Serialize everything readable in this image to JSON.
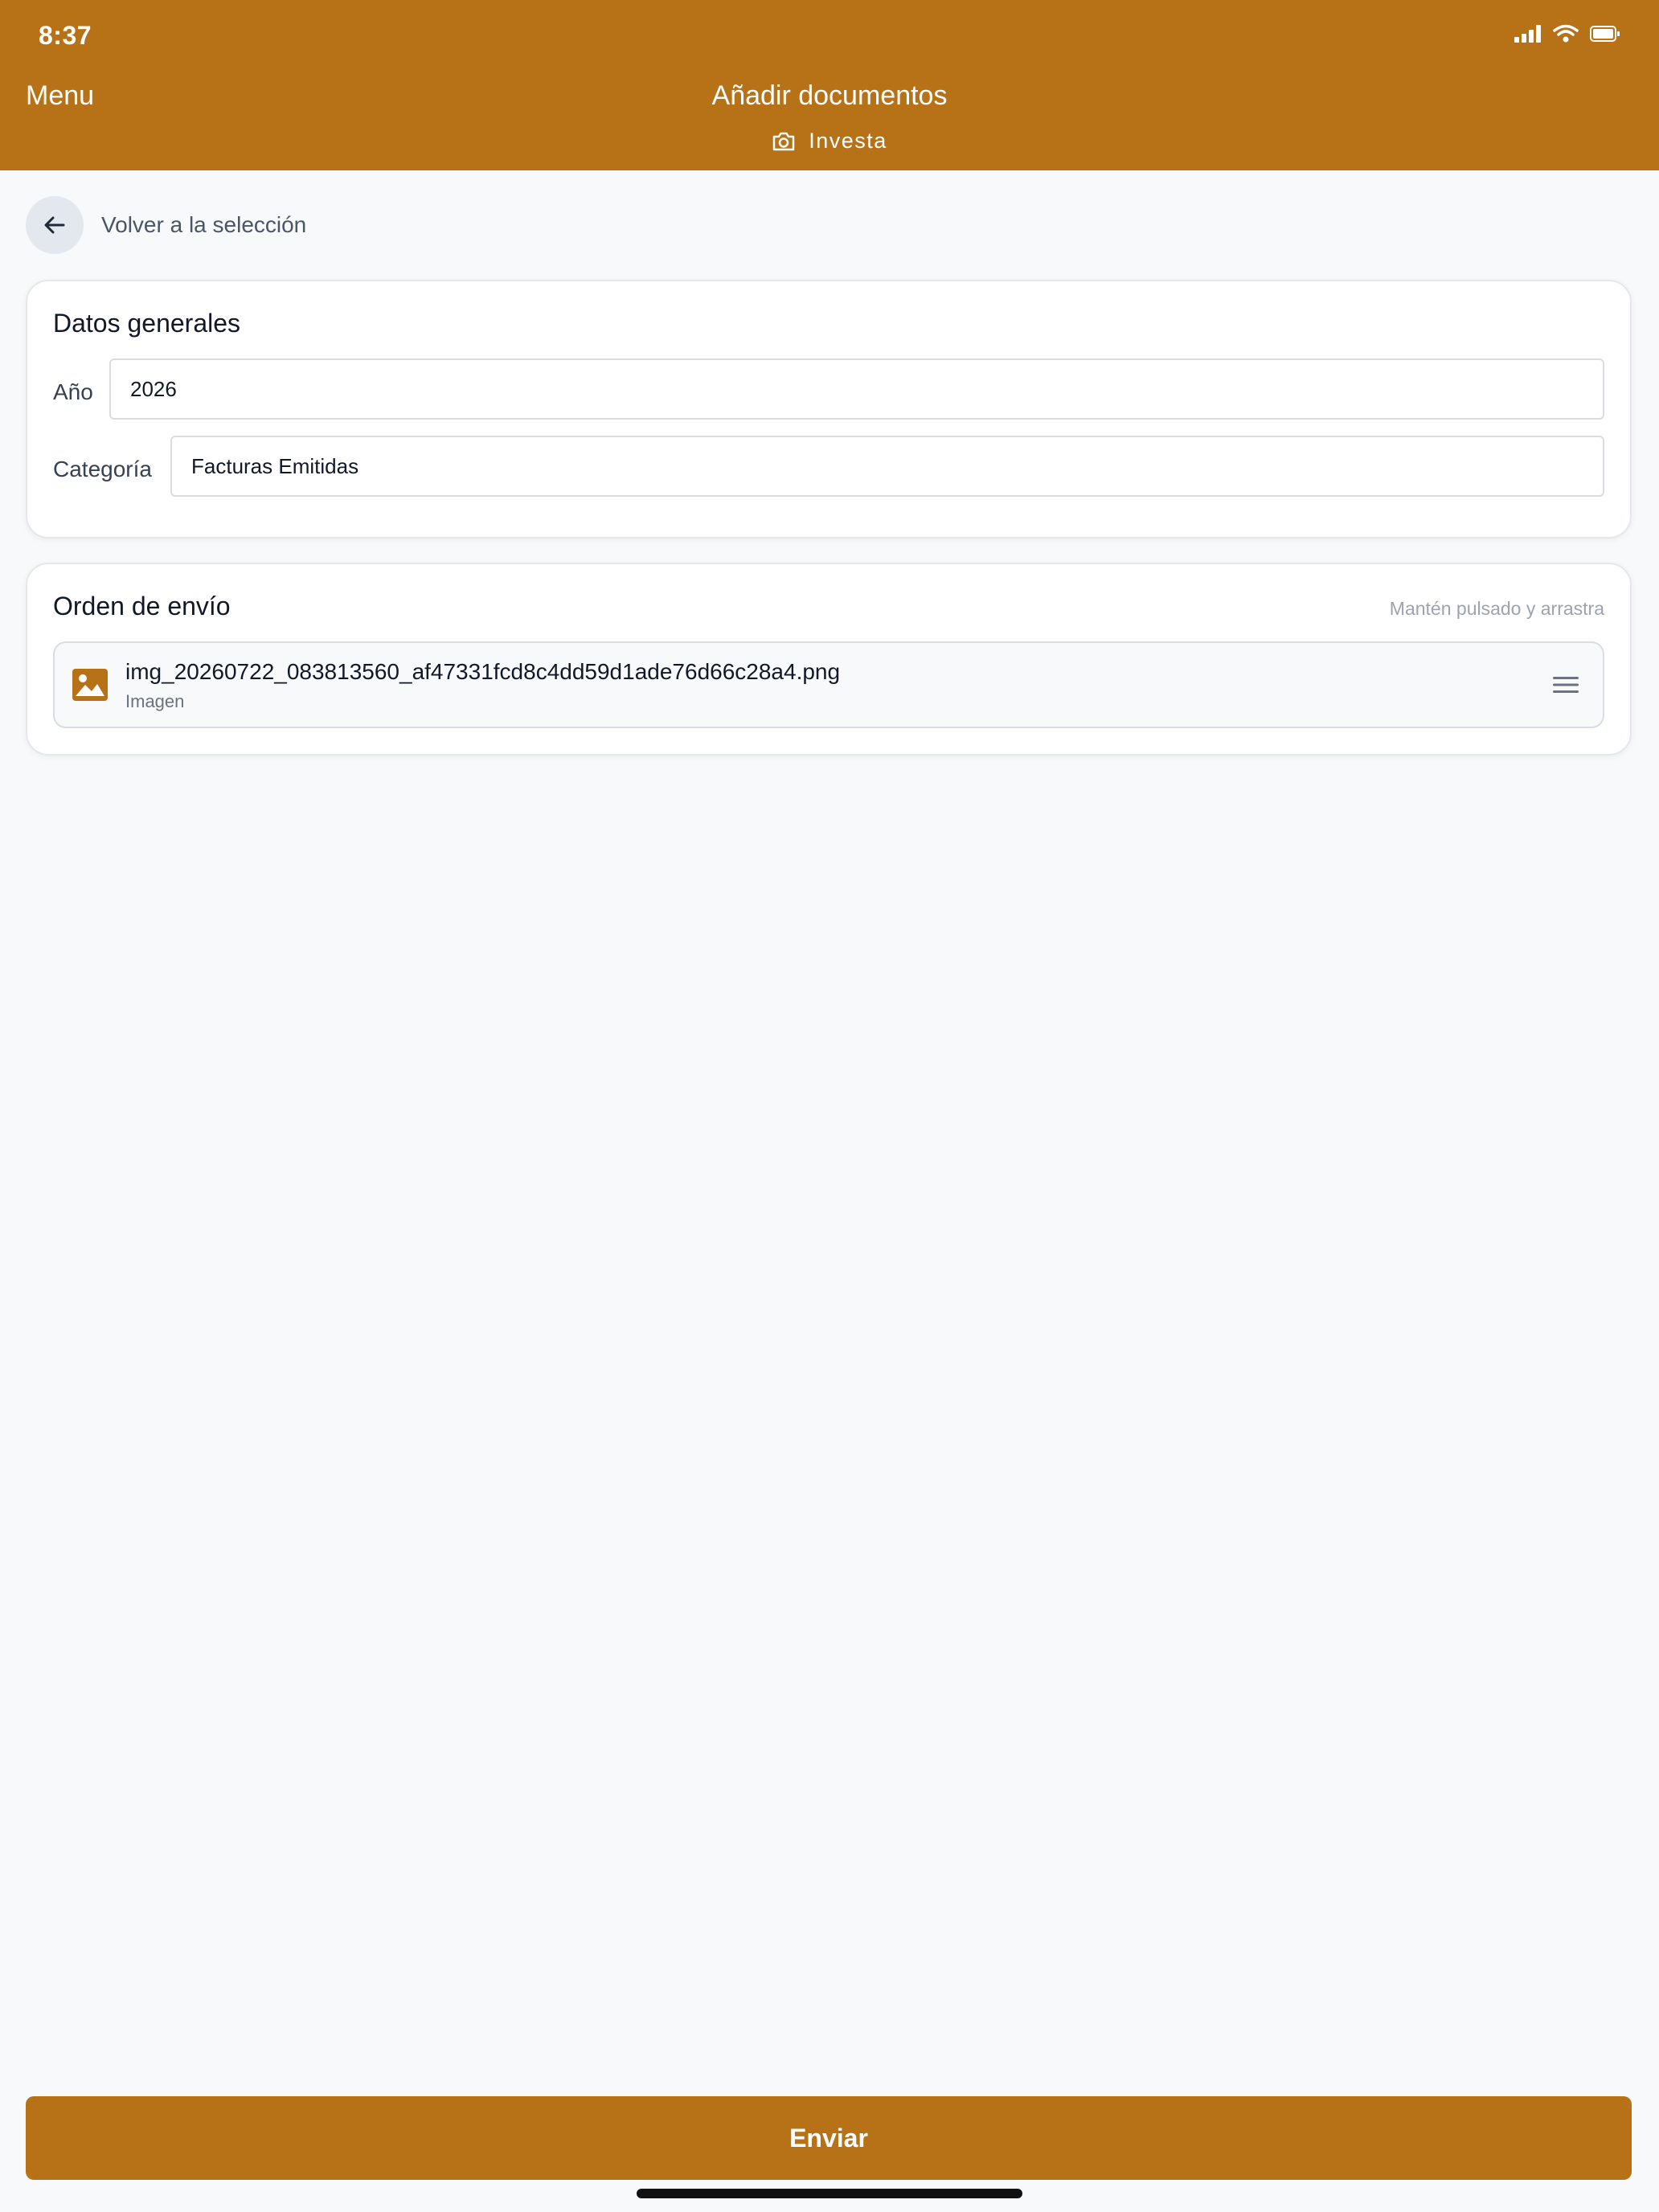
{
  "status_bar": {
    "time": "8:37"
  },
  "nav": {
    "menu_label": "Menu",
    "title": "Añadir documentos",
    "subtitle": "Investa",
    "subtitle_icon": "camera-icon"
  },
  "back": {
    "label": "Volver a la selección"
  },
  "general": {
    "title": "Datos generales",
    "year_label": "Año",
    "year_value": "2026",
    "category_label": "Categoría",
    "category_value": "Facturas Emitidas"
  },
  "order": {
    "title": "Orden de envío",
    "hint": "Mantén pulsado y arrastra",
    "items": [
      {
        "name": "img_20260722_083813560_af47331fcd8c4dd59d1ade76d66c28a4.png",
        "type": "Imagen",
        "icon": "image-icon"
      }
    ]
  },
  "submit_label": "Enviar",
  "colors": {
    "accent": "#b77218",
    "background": "#f7f9fb"
  }
}
